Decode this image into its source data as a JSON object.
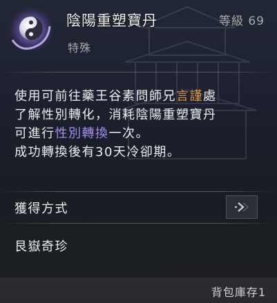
{
  "item": {
    "icon": "yin-yang-orb-icon",
    "name": "陰陽重塑寶丹",
    "category": "特殊",
    "level": "等級 69"
  },
  "description": {
    "line1": {
      "pre": "使用可前往藥王谷素問師兄",
      "highlight": "言謹",
      "post": "處"
    },
    "line2": "了解性別轉化，消耗陰陽重塑寶丹",
    "line3": {
      "pre": "可進行",
      "highlight": "性別轉換",
      "post": "一次。"
    },
    "line4": "成功轉換後有30天冷卻期。"
  },
  "obtain": {
    "label": "獲得方式",
    "button_icon": "chevron-right-icon"
  },
  "source": "艮嶽奇珍",
  "footer": {
    "bag_stock": "背包庫存1"
  },
  "colors": {
    "highlight_orange": "#e39645",
    "highlight_purple": "#a58cf2",
    "text_primary": "#eeeeee",
    "text_secondary": "#a9a9a9"
  }
}
